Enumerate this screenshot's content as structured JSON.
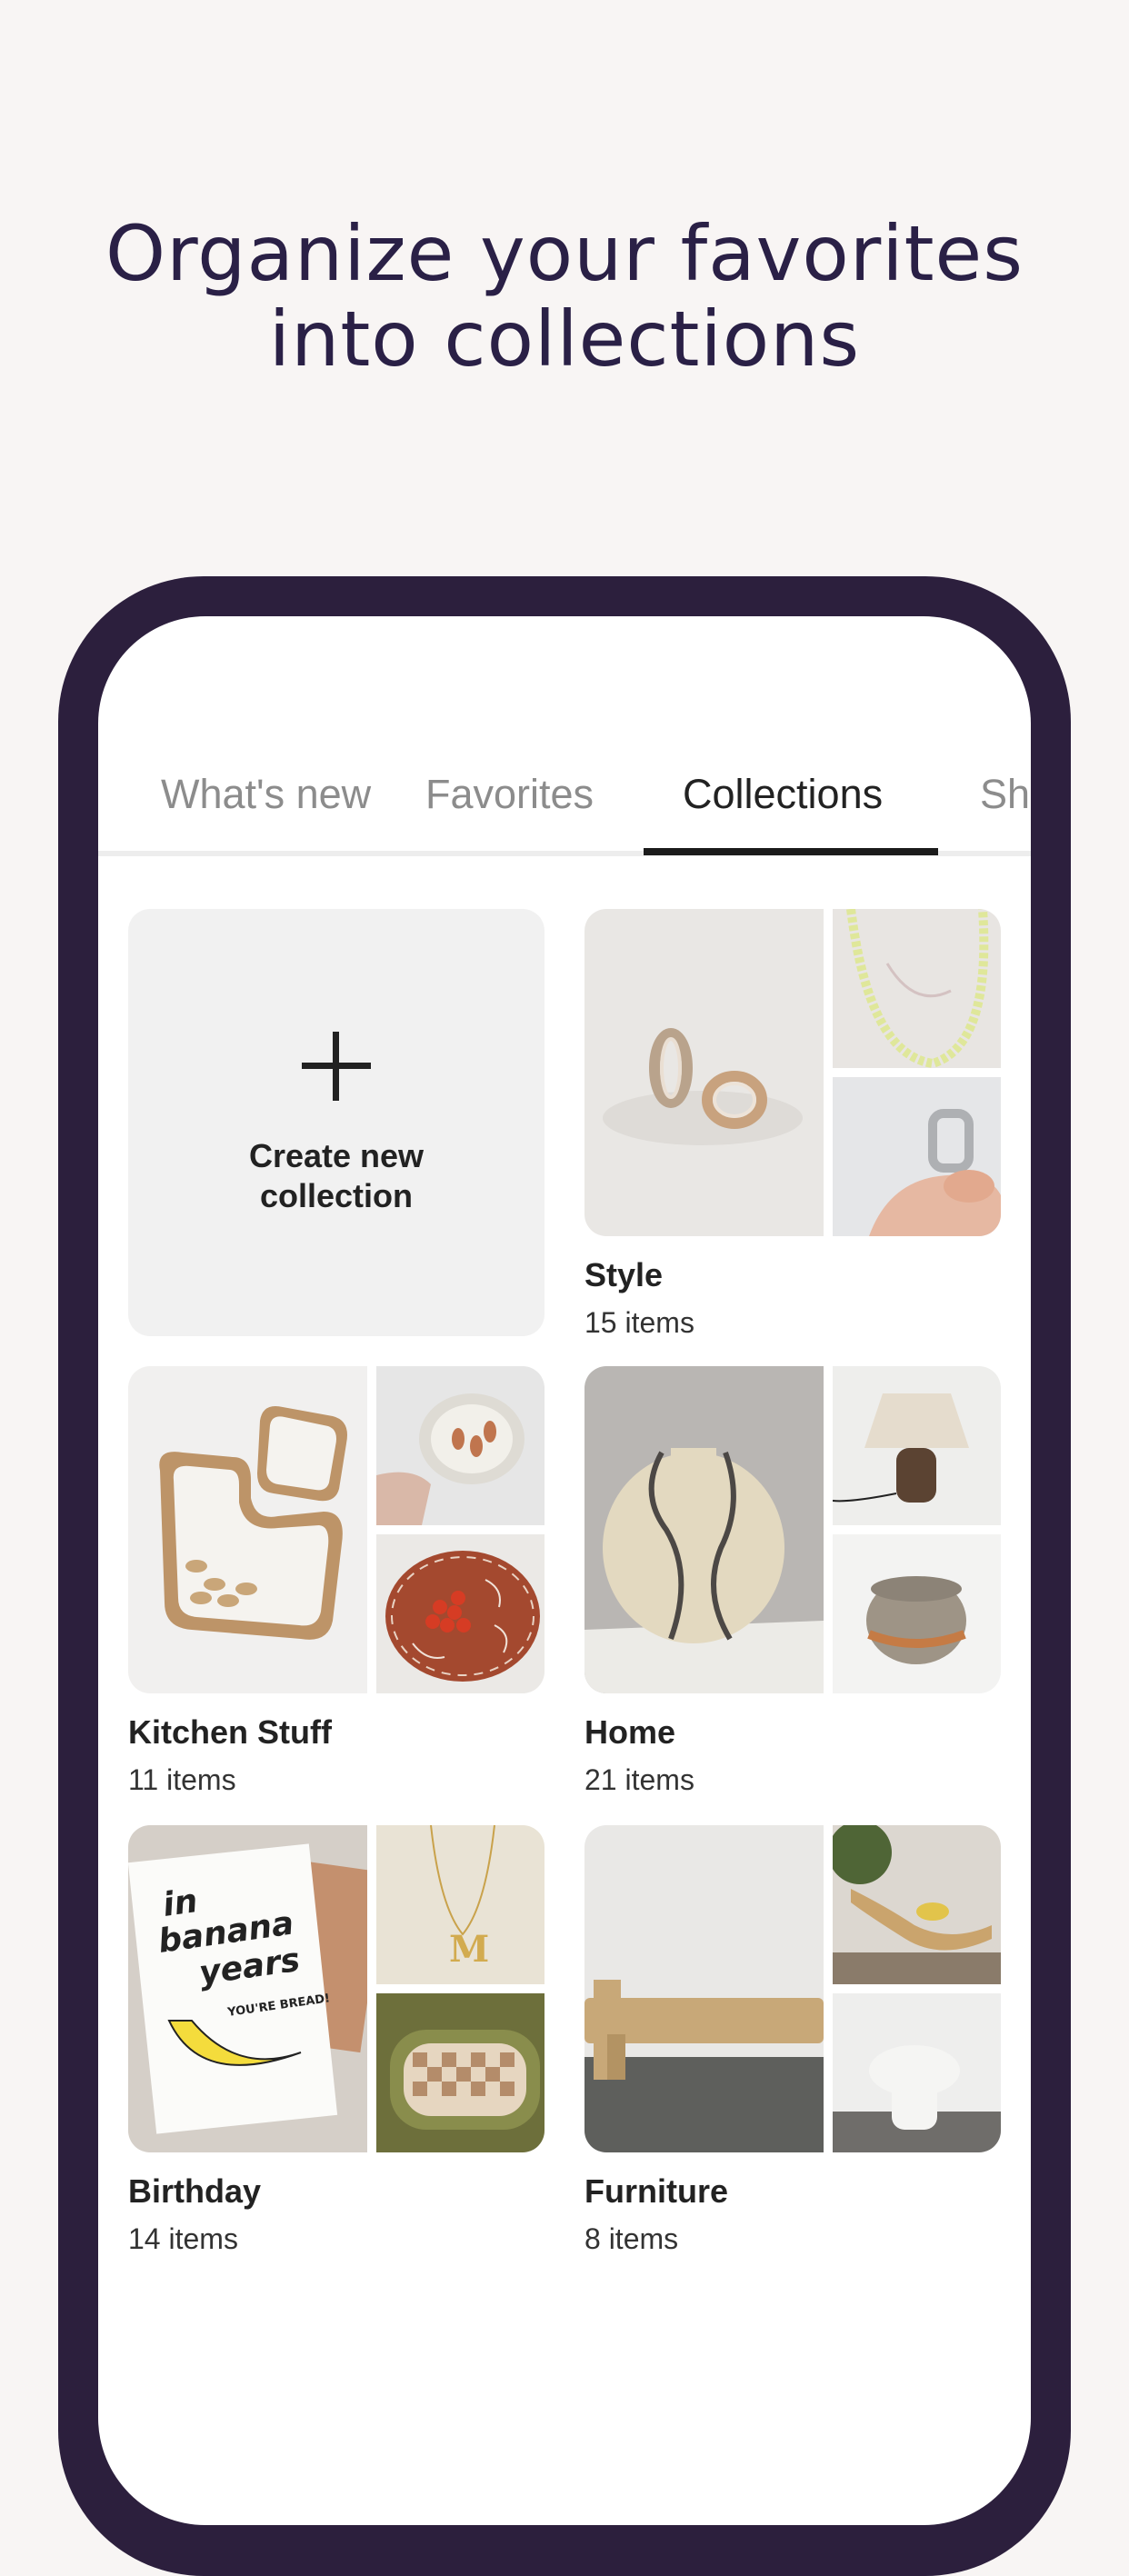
{
  "headline": {
    "line1": "Organize your favorites",
    "line2": "into collections"
  },
  "tabs": [
    {
      "label": "What's new",
      "active": false
    },
    {
      "label": "Favorites",
      "active": false
    },
    {
      "label": "Collections",
      "active": true
    },
    {
      "label": "Sh",
      "active": false
    }
  ],
  "create": {
    "line1": "Create new",
    "line2": "collection"
  },
  "collections": [
    {
      "title": "Style",
      "count": "15 items"
    },
    {
      "title": "Kitchen Stuff",
      "count": "11 items"
    },
    {
      "title": "Home",
      "count": "21 items"
    },
    {
      "title": "Birthday",
      "count": "14 items"
    },
    {
      "title": "Furniture",
      "count": "8 items"
    }
  ],
  "card_art": {
    "in_text": "in",
    "banana_text": "banana",
    "years_text": "years",
    "bread_text": "YOU'RE BREAD!"
  },
  "colors": {
    "background": "#f8f5f4",
    "headline": "#2a2046",
    "phone_frame": "#2c1f3d",
    "active_tab": "#222222",
    "inactive_tab": "#8c8c8c"
  }
}
